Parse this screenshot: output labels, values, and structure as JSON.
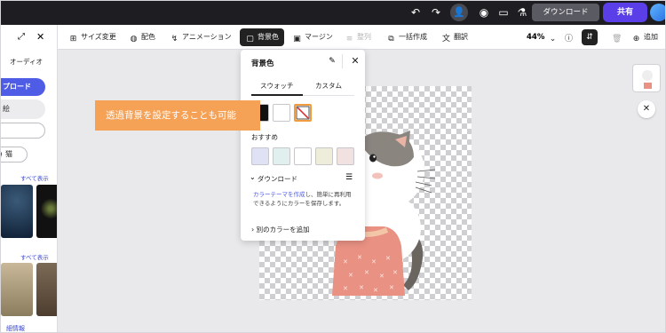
{
  "topbar": {
    "download_label": "ダウンロード",
    "share_label": "共有"
  },
  "toolbar": {
    "items": [
      {
        "label": "サイズ変更"
      },
      {
        "label": "配色"
      },
      {
        "label": "アニメーション"
      },
      {
        "label": "背景色"
      },
      {
        "label": "マージン"
      },
      {
        "label": "整列"
      },
      {
        "label": "一括作成"
      },
      {
        "label": "翻訳"
      }
    ],
    "zoom": "44%",
    "add_label": "追加"
  },
  "left_panel": {
    "audio_label": "オーディオ",
    "upload_label": "プロード",
    "gray_label": "絵",
    "search_chip": "猫",
    "see_all_1": "すべて表示",
    "see_all_2": "すべて表示",
    "detail_link": "細情報"
  },
  "popup": {
    "title": "背景色",
    "tab_swatch": "スウォッチ",
    "tab_custom": "カスタム",
    "recommend_label": "おすすめ",
    "download_label": "ダウンロード",
    "desc_link": "カラーテーマを作成",
    "desc_rest": "し、簡単に再利用できるようにカラーを保存します。",
    "add_color": "別のカラーを追加",
    "swatches_recommended": [
      "#dfe2f4",
      "#e1f0ef",
      "#ffffff",
      "#eeedd9",
      "#f1e1e1"
    ]
  },
  "banner": {
    "text": "透過背景を設定することも可能"
  },
  "colors": {
    "accent": "#4f5de6",
    "share": "#5a3ee8",
    "banner": "#f5a156",
    "topbar": "#1e1e22"
  }
}
